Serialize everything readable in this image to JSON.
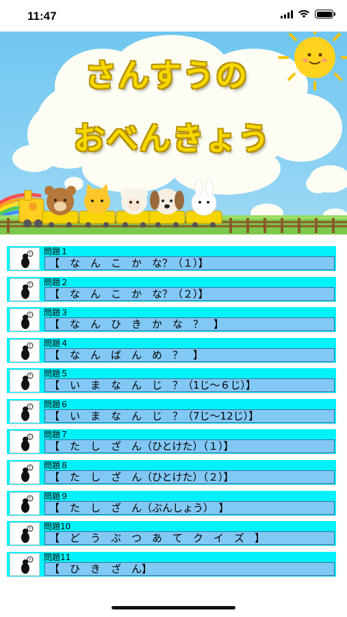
{
  "status_bar": {
    "time": "11:47"
  },
  "banner": {
    "title_line1": "さんすうの",
    "title_line2": "おべんきょう"
  },
  "items": [
    {
      "number": "問題１",
      "title": "【　な　ん　こ　か　な？（１）】"
    },
    {
      "number": "問題２",
      "title": "【　な　ん　こ　か　な？（２）】"
    },
    {
      "number": "問題３",
      "title": "【　な　ん　ひ　き　か　な　？　】"
    },
    {
      "number": "問題４",
      "title": "【　な　ん　ば　ん　め　？　】"
    },
    {
      "number": "問題５",
      "title": "【　い　ま　な　ん　じ　？（1じ～６じ）】"
    },
    {
      "number": "問題６",
      "title": "【　い　ま　な　ん　じ　？（7じ～12じ）】"
    },
    {
      "number": "問題７",
      "title": "【　た　し　ざ　ん（ひとけた）（１）】"
    },
    {
      "number": "問題８",
      "title": "【　た　し　ざ　ん（ひとけた）（２）】"
    },
    {
      "number": "問題９",
      "title": "【　た　し　ざ　ん（ぶんしょう）　】"
    },
    {
      "number": "問題10",
      "title": "【　ど　う　ぶ　つ　あ　て　ク　イ　ズ　】"
    },
    {
      "number": "問題11",
      "title": "【　ひ　き　ざ　ん】"
    }
  ]
}
